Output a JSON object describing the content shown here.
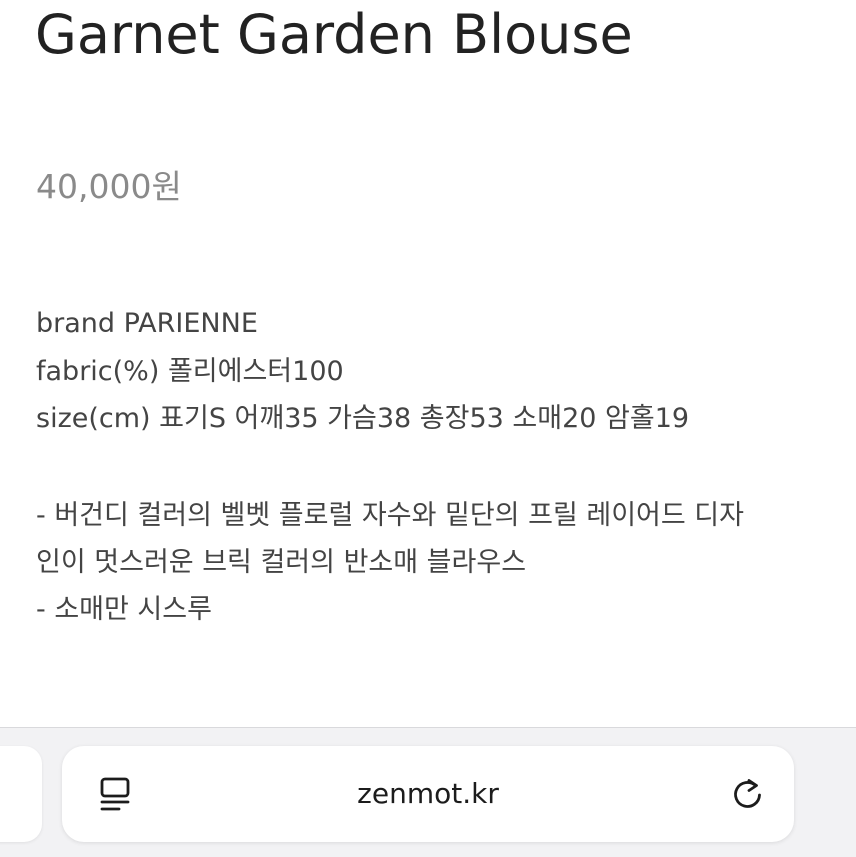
{
  "product": {
    "title": "Garnet Garden Blouse",
    "price": "40,000원",
    "details": {
      "brand": "brand PARIENNE",
      "fabric": "fabric(%) 폴리에스터100",
      "size": "size(cm) 표기S 어깨35 가슴38 총장53 소매20 암홀19"
    },
    "description": {
      "line1": "- 버건디 컬러의 벨벳 플로럴 자수와 밑단의 프릴 레이어드 디자",
      "line2": "인이 멋스러운 브릭 컬러의 반소매 블라우스",
      "line3": "- 소매만 시스루"
    }
  },
  "browser": {
    "url": "zenmot.kr",
    "icons": {
      "reader": "reader-mode-icon",
      "reload": "reload-icon"
    }
  }
}
